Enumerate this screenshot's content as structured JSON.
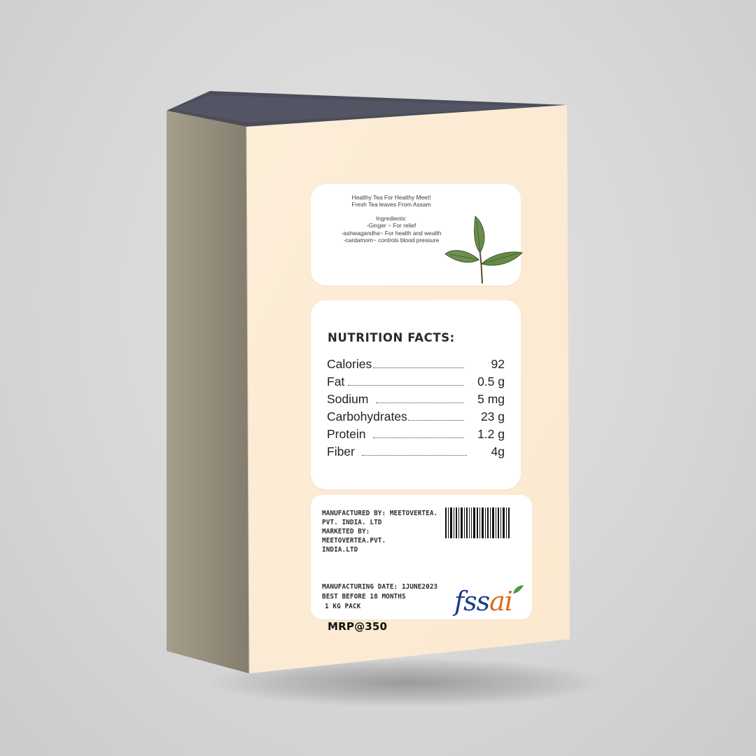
{
  "product": {
    "tagline_1": "Healthy Tea For Healthy Meet!",
    "tagline_2": "Fresh Tea leaves From Assam",
    "ingredients_heading": "Ingredients:",
    "ingredients": [
      "-Ginger ~ For relief",
      "-ashwagandha~ For health and wealth",
      "-cardamom~ controls blood pressure"
    ]
  },
  "nutrition": {
    "title": "NUTRITION FACTS:",
    "rows": [
      {
        "label": "Calories",
        "value": "92"
      },
      {
        "label": "Fat",
        "value": "0.5 g"
      },
      {
        "label": "Sodium",
        "value": "5 mg"
      },
      {
        "label": "Carbohydrates",
        "value": "23 g"
      },
      {
        "label": "Protein",
        "value": "1.2 g"
      },
      {
        "label": "Fiber",
        "value": "4g"
      }
    ]
  },
  "info": {
    "manufactured_line_1": "MANUFACTURED BY: MEETOVERTEA.",
    "manufactured_line_2": "PVT. INDIA. LTD",
    "marketed_line_1": "MARKETED BY:",
    "marketed_line_2": "MEETOVERTEA.PVT.",
    "marketed_line_3": "INDIA.LTD",
    "mfg_date": "MANUFACTURING DATE: 1JUNE2023",
    "best_before": "BEST BEFORE 18 MONTHS",
    "pack": "1 KG PACK",
    "mrp": "MRP@350",
    "logo_text_a": "fss",
    "logo_text_b": "ai"
  },
  "colors": {
    "box_front": "#fdecd5",
    "box_side": "#8f8878",
    "box_top": "#4a4c58",
    "leaf": "#6a8a4a",
    "logo_blue": "#1e3b8a",
    "logo_orange": "#e06a1b"
  },
  "icons": [
    "tea-leaf-icon",
    "barcode-icon",
    "fssai-logo-icon"
  ]
}
